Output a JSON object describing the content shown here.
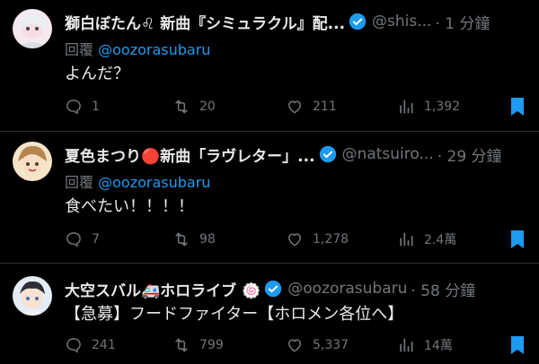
{
  "tweets": [
    {
      "name": "獅白ぼたん♌ 新曲『シミュラクル』配...",
      "handle": "@shis...",
      "time": "· 1 分鐘",
      "reply_prefix": "回覆",
      "reply_to": "@oozorasubaru",
      "text": "よんだ？",
      "replies": "1",
      "retweets": "20",
      "likes": "211",
      "views": "1,392"
    },
    {
      "name": "夏色まつり🔴新曲「ラヴレター」...",
      "handle": "@natsuiro...",
      "time": "· 29 分鐘",
      "reply_prefix": "回覆",
      "reply_to": "@oozorasubaru",
      "text": "食べたい！！！！",
      "replies": "7",
      "retweets": "98",
      "likes": "1,278",
      "views": "2.4萬"
    },
    {
      "name": "大空スバル🚑ホロライブ 🍥",
      "handle": "@oozorasubaru",
      "time": "· 58 分鐘",
      "text": "【急募】フードファイター【ホロメン各位へ】",
      "replies": "241",
      "retweets": "799",
      "likes": "5,337",
      "views": "14萬"
    }
  ],
  "colors": {
    "background": "#000000",
    "text": "#e7e9ea",
    "muted": "#71767b",
    "accent": "#1d9bf0",
    "divider": "#2f3336"
  }
}
